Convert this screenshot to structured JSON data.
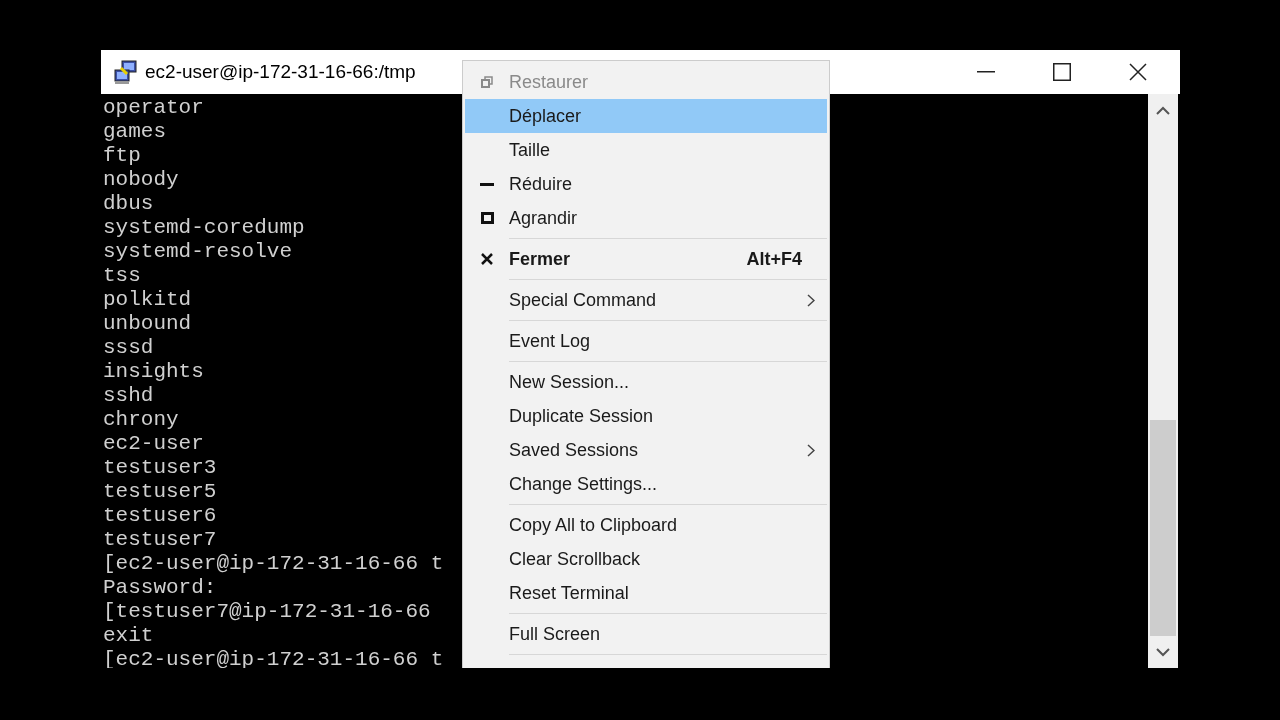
{
  "window": {
    "title": "ec2-user@ip-172-31-16-66:/tmp"
  },
  "terminal": {
    "lines": [
      "operator",
      "games",
      "ftp",
      "nobody",
      "dbus",
      "systemd-coredump",
      "systemd-resolve",
      "tss",
      "polkitd",
      "unbound",
      "sssd",
      "insights",
      "sshd",
      "chrony",
      "ec2-user",
      "testuser3",
      "testuser5",
      "testuser6",
      "testuser7",
      "[ec2-user@ip-172-31-16-66 t",
      "Password:",
      "[testuser7@ip-172-31-16-66",
      "exit",
      "[ec2-user@ip-172-31-16-66 t"
    ]
  },
  "context_menu": {
    "items": [
      {
        "kind": "restore",
        "label": "Restaurer",
        "selected": false,
        "disabled": true
      },
      {
        "kind": "item",
        "label": "Déplacer",
        "selected": true,
        "disabled": false
      },
      {
        "kind": "item",
        "label": "Taille",
        "selected": false,
        "disabled": false
      },
      {
        "kind": "minimize",
        "label": "Réduire",
        "selected": false,
        "disabled": false
      },
      {
        "kind": "maximize",
        "label": "Agrandir",
        "selected": false,
        "disabled": false
      },
      {
        "kind": "separator"
      },
      {
        "kind": "close",
        "label": "Fermer",
        "shortcut": "Alt+F4",
        "selected": false,
        "disabled": false
      },
      {
        "kind": "separator"
      },
      {
        "kind": "item",
        "label": "Special Command",
        "submenu": true,
        "selected": false,
        "disabled": false
      },
      {
        "kind": "separator"
      },
      {
        "kind": "item",
        "label": "Event Log",
        "selected": false,
        "disabled": false
      },
      {
        "kind": "separator"
      },
      {
        "kind": "item",
        "label": "New Session...",
        "selected": false,
        "disabled": false
      },
      {
        "kind": "item",
        "label": "Duplicate Session",
        "selected": false,
        "disabled": false
      },
      {
        "kind": "item",
        "label": "Saved Sessions",
        "submenu": true,
        "selected": false,
        "disabled": false
      },
      {
        "kind": "item",
        "label": "Change Settings...",
        "selected": false,
        "disabled": false
      },
      {
        "kind": "separator"
      },
      {
        "kind": "item",
        "label": "Copy All to Clipboard",
        "selected": false,
        "disabled": false
      },
      {
        "kind": "item",
        "label": "Clear Scrollback",
        "selected": false,
        "disabled": false
      },
      {
        "kind": "item",
        "label": "Reset Terminal",
        "selected": false,
        "disabled": false
      },
      {
        "kind": "separator"
      },
      {
        "kind": "item",
        "label": "Full Screen",
        "selected": false,
        "disabled": false
      },
      {
        "kind": "separator"
      }
    ]
  }
}
